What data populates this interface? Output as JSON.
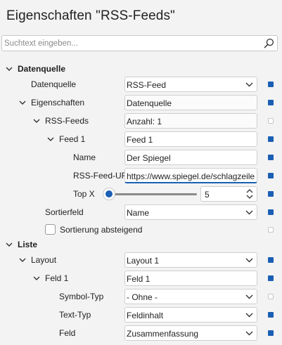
{
  "title": "Eigenschaften \"RSS-Feeds\"",
  "search": {
    "placeholder": "Suchtext eingeben...",
    "value": ""
  },
  "sections": {
    "datenquelle": "Datenquelle",
    "liste": "Liste"
  },
  "rows": {
    "datenquelle": {
      "label": "Datenquelle",
      "value": "RSS-Feed"
    },
    "eigenschaften": {
      "label": "Eigenschaften",
      "value": "Datenquelle"
    },
    "rssfeeds": {
      "label": "RSS-Feeds",
      "value": "Anzahl: 1"
    },
    "feed1": {
      "label": "Feed 1",
      "value": "Feed 1"
    },
    "name": {
      "label": "Name",
      "value": "Der Spiegel"
    },
    "rssurl": {
      "label": "RSS-Feed-URL",
      "value": "https://www.spiegel.de/schlagzeilen/"
    },
    "topx": {
      "label": "Top X",
      "value": "5",
      "slider_fraction": 0
    },
    "sortierfeld": {
      "label": "Sortierfeld",
      "value": "Name"
    },
    "sortabst": {
      "label": "Sortierung absteigend",
      "checked": false
    },
    "layout": {
      "label": "Layout",
      "value": "Layout 1"
    },
    "feld1": {
      "label": "Feld 1",
      "value": "Feld 1"
    },
    "symboltyp": {
      "label": "Symbol-Typ",
      "value": "- Ohne -"
    },
    "texttyp": {
      "label": "Text-Typ",
      "value": "Feldinhalt"
    },
    "feld": {
      "label": "Feld",
      "value": "Zusammenfassung"
    }
  },
  "colors": {
    "accent": "#1a5fb4",
    "background": "#f3f3f3"
  },
  "icons": {
    "search": "magnifier-icon",
    "dropdown": "chevron-down-icon",
    "expand": "chevron-down-icon"
  }
}
